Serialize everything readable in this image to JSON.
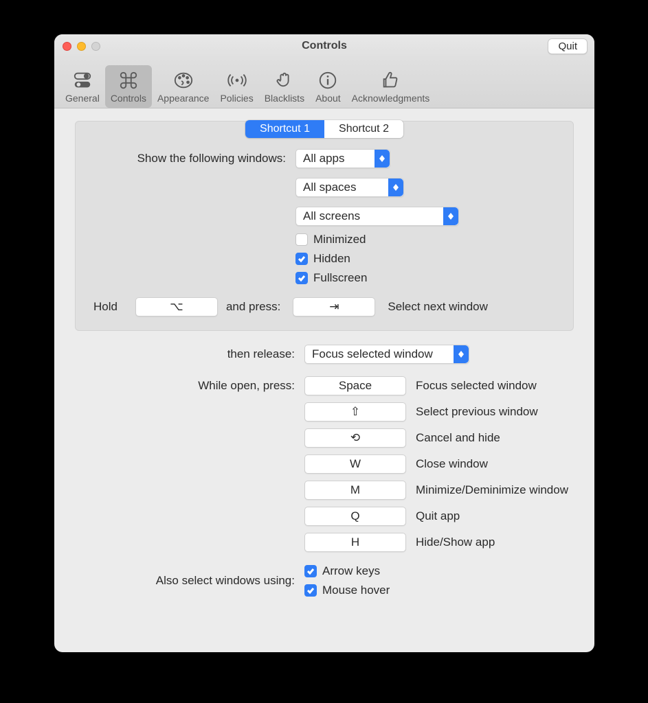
{
  "title": "Controls",
  "quit": "Quit",
  "toolbar": [
    {
      "id": "general",
      "label": "General"
    },
    {
      "id": "controls",
      "label": "Controls"
    },
    {
      "id": "appearance",
      "label": "Appearance"
    },
    {
      "id": "policies",
      "label": "Policies"
    },
    {
      "id": "blacklists",
      "label": "Blacklists"
    },
    {
      "id": "about",
      "label": "About"
    },
    {
      "id": "ack",
      "label": "Acknowledgments"
    }
  ],
  "tabs": [
    "Shortcut 1",
    "Shortcut 2"
  ],
  "labels": {
    "showWindows": "Show the following windows:",
    "hold": "Hold",
    "andPress": "and press:",
    "selectNext": "Select next window",
    "thenRelease": "then release:",
    "whileOpen": "While open, press:",
    "alsoSelect": "Also select windows using:"
  },
  "popups": {
    "apps": "All apps",
    "spaces": "All spaces",
    "screens": "All screens",
    "release": "Focus selected window"
  },
  "checks": {
    "minimized": {
      "label": "Minimized",
      "on": false
    },
    "hidden": {
      "label": "Hidden",
      "on": true
    },
    "fullscreen": {
      "label": "Fullscreen",
      "on": true
    },
    "arrow": {
      "label": "Arrow keys",
      "on": true
    },
    "hover": {
      "label": "Mouse hover",
      "on": true
    }
  },
  "keys": {
    "hold": "⌥",
    "press": "⇥",
    "space": "Space",
    "prev": "⇧",
    "cancel": "⟲",
    "close": "W",
    "min": "M",
    "quit": "Q",
    "hide": "H"
  },
  "actions": {
    "space": "Focus selected window",
    "prev": "Select previous window",
    "cancel": "Cancel and hide",
    "close": "Close window",
    "min": "Minimize/Deminimize window",
    "quit": "Quit app",
    "hide": "Hide/Show app"
  }
}
